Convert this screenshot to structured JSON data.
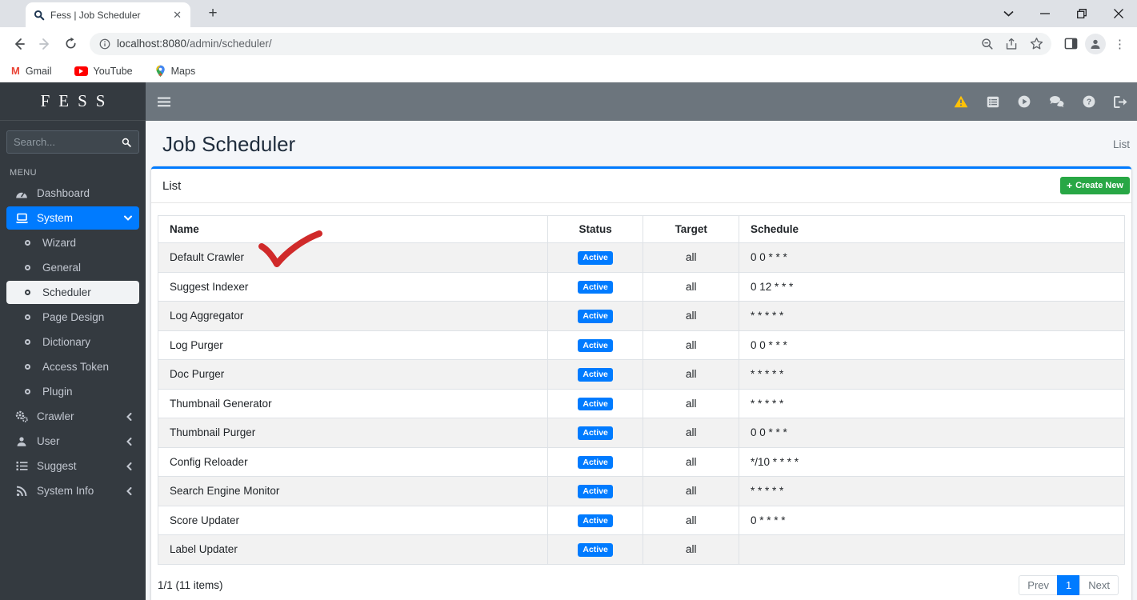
{
  "browser": {
    "tab_title": "Fess | Job Scheduler",
    "url_host": "localhost:8080",
    "url_path": "/admin/scheduler/",
    "bookmarks": [
      {
        "label": "Gmail"
      },
      {
        "label": "YouTube"
      },
      {
        "label": "Maps"
      }
    ]
  },
  "sidebar": {
    "brand": "FESS",
    "search_placeholder": "Search...",
    "menu_label": "MENU",
    "items": [
      {
        "label": "Dashboard"
      },
      {
        "label": "System"
      },
      {
        "label": "Wizard"
      },
      {
        "label": "General"
      },
      {
        "label": "Scheduler"
      },
      {
        "label": "Page Design"
      },
      {
        "label": "Dictionary"
      },
      {
        "label": "Access Token"
      },
      {
        "label": "Plugin"
      },
      {
        "label": "Crawler"
      },
      {
        "label": "User"
      },
      {
        "label": "Suggest"
      },
      {
        "label": "System Info"
      }
    ]
  },
  "page": {
    "title": "Job Scheduler",
    "breadcrumb": "List",
    "card_title": "List",
    "create_button_label": "Create New"
  },
  "table": {
    "columns": [
      "Name",
      "Status",
      "Target",
      "Schedule"
    ],
    "rows": [
      {
        "name": "Default Crawler",
        "status": "Active",
        "target": "all",
        "schedule": "0 0 * * *"
      },
      {
        "name": "Suggest Indexer",
        "status": "Active",
        "target": "all",
        "schedule": "0 12 * * *"
      },
      {
        "name": "Log Aggregator",
        "status": "Active",
        "target": "all",
        "schedule": "* * * * *"
      },
      {
        "name": "Log Purger",
        "status": "Active",
        "target": "all",
        "schedule": "0 0 * * *"
      },
      {
        "name": "Doc Purger",
        "status": "Active",
        "target": "all",
        "schedule": "* * * * *"
      },
      {
        "name": "Thumbnail Generator",
        "status": "Active",
        "target": "all",
        "schedule": "* * * * *"
      },
      {
        "name": "Thumbnail Purger",
        "status": "Active",
        "target": "all",
        "schedule": "0 0 * * *"
      },
      {
        "name": "Config Reloader",
        "status": "Active",
        "target": "all",
        "schedule": "*/10 * * * *"
      },
      {
        "name": "Search Engine Monitor",
        "status": "Active",
        "target": "all",
        "schedule": "* * * * *"
      },
      {
        "name": "Score Updater",
        "status": "Active",
        "target": "all",
        "schedule": "0 * * * *"
      },
      {
        "name": "Label Updater",
        "status": "Active",
        "target": "all",
        "schedule": ""
      }
    ]
  },
  "footer": {
    "count": "1/1 (11 items)",
    "pagination": {
      "prev": "Prev",
      "page": "1",
      "next": "Next"
    }
  },
  "icons": {
    "navbar": [
      "warning-icon",
      "list-alt-icon",
      "play-circle-icon",
      "comments-icon",
      "question-circle-icon",
      "sign-out-icon"
    ],
    "sidebar": [
      "tachometer-icon",
      "laptop-icon",
      "circle-bullet-icon",
      "cogs-icon",
      "user-icon",
      "list-icon",
      "rss-icon"
    ]
  },
  "colors": {
    "accent": "#007bff",
    "success": "#28a745",
    "warning": "#ffc107",
    "sidebar_bg": "#343a40",
    "navbar_bg": "#6c757d",
    "annotation_red": "#d02a2a"
  }
}
